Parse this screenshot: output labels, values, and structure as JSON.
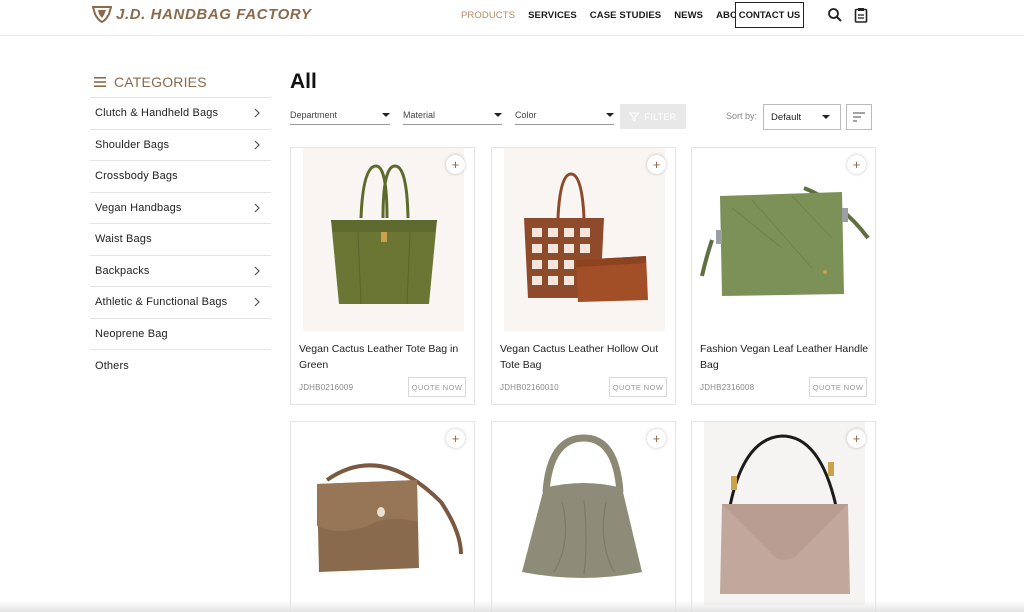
{
  "brand": {
    "name": "J.D. HANDBAG FACTORY",
    "logo_icon": "shield-logo-icon",
    "brand_color": "#8a6a4c"
  },
  "nav": {
    "items": [
      {
        "label": "PRODUCTS",
        "active": true
      },
      {
        "label": "SERVICES",
        "active": false
      },
      {
        "label": "CASE STUDIES",
        "active": false
      },
      {
        "label": "NEWS",
        "active": false
      },
      {
        "label": "ABOUT",
        "active": false
      }
    ],
    "contact_label": "CONTACT US",
    "search_icon": "search-icon",
    "quote_list_icon": "clipboard-icon"
  },
  "sidebar": {
    "title": "CATEGORIES",
    "items": [
      {
        "label": "Clutch & Handheld Bags",
        "has_children": true
      },
      {
        "label": "Shoulder Bags",
        "has_children": true
      },
      {
        "label": "Crossbody Bags",
        "has_children": false
      },
      {
        "label": "Vegan Handbags",
        "has_children": true
      },
      {
        "label": "Waist Bags",
        "has_children": false
      },
      {
        "label": "Backpacks",
        "has_children": true
      },
      {
        "label": "Athletic & Functional Bags",
        "has_children": true
      },
      {
        "label": "Neoprene Bag",
        "has_children": false
      },
      {
        "label": "Others",
        "has_children": false
      }
    ]
  },
  "main": {
    "title": "All",
    "filters": {
      "department": "Department",
      "material": "Material",
      "color": "Color",
      "filter_button": "FILTER"
    },
    "sort": {
      "label": "Sort by:",
      "value": "Default"
    },
    "quote_label": "QUOTE NOW",
    "products": [
      {
        "name": "Vegan Cactus Leather Tote Bag in Green",
        "sku": "JDHB0216009",
        "image": "green-tote"
      },
      {
        "name": "Vegan Cactus Leather Hollow Out Tote Bag",
        "sku": "JDHB02160010",
        "image": "brown-woven-tote"
      },
      {
        "name": "Fashion Vegan Leaf Leather Handle Bag",
        "sku": "JDHB2316008",
        "image": "green-leaf-bag"
      },
      {
        "name": "",
        "sku": "",
        "image": "brown-crossbody"
      },
      {
        "name": "",
        "sku": "",
        "image": "grey-hobo"
      },
      {
        "name": "",
        "sku": "",
        "image": "pink-envelope-bag"
      }
    ]
  }
}
